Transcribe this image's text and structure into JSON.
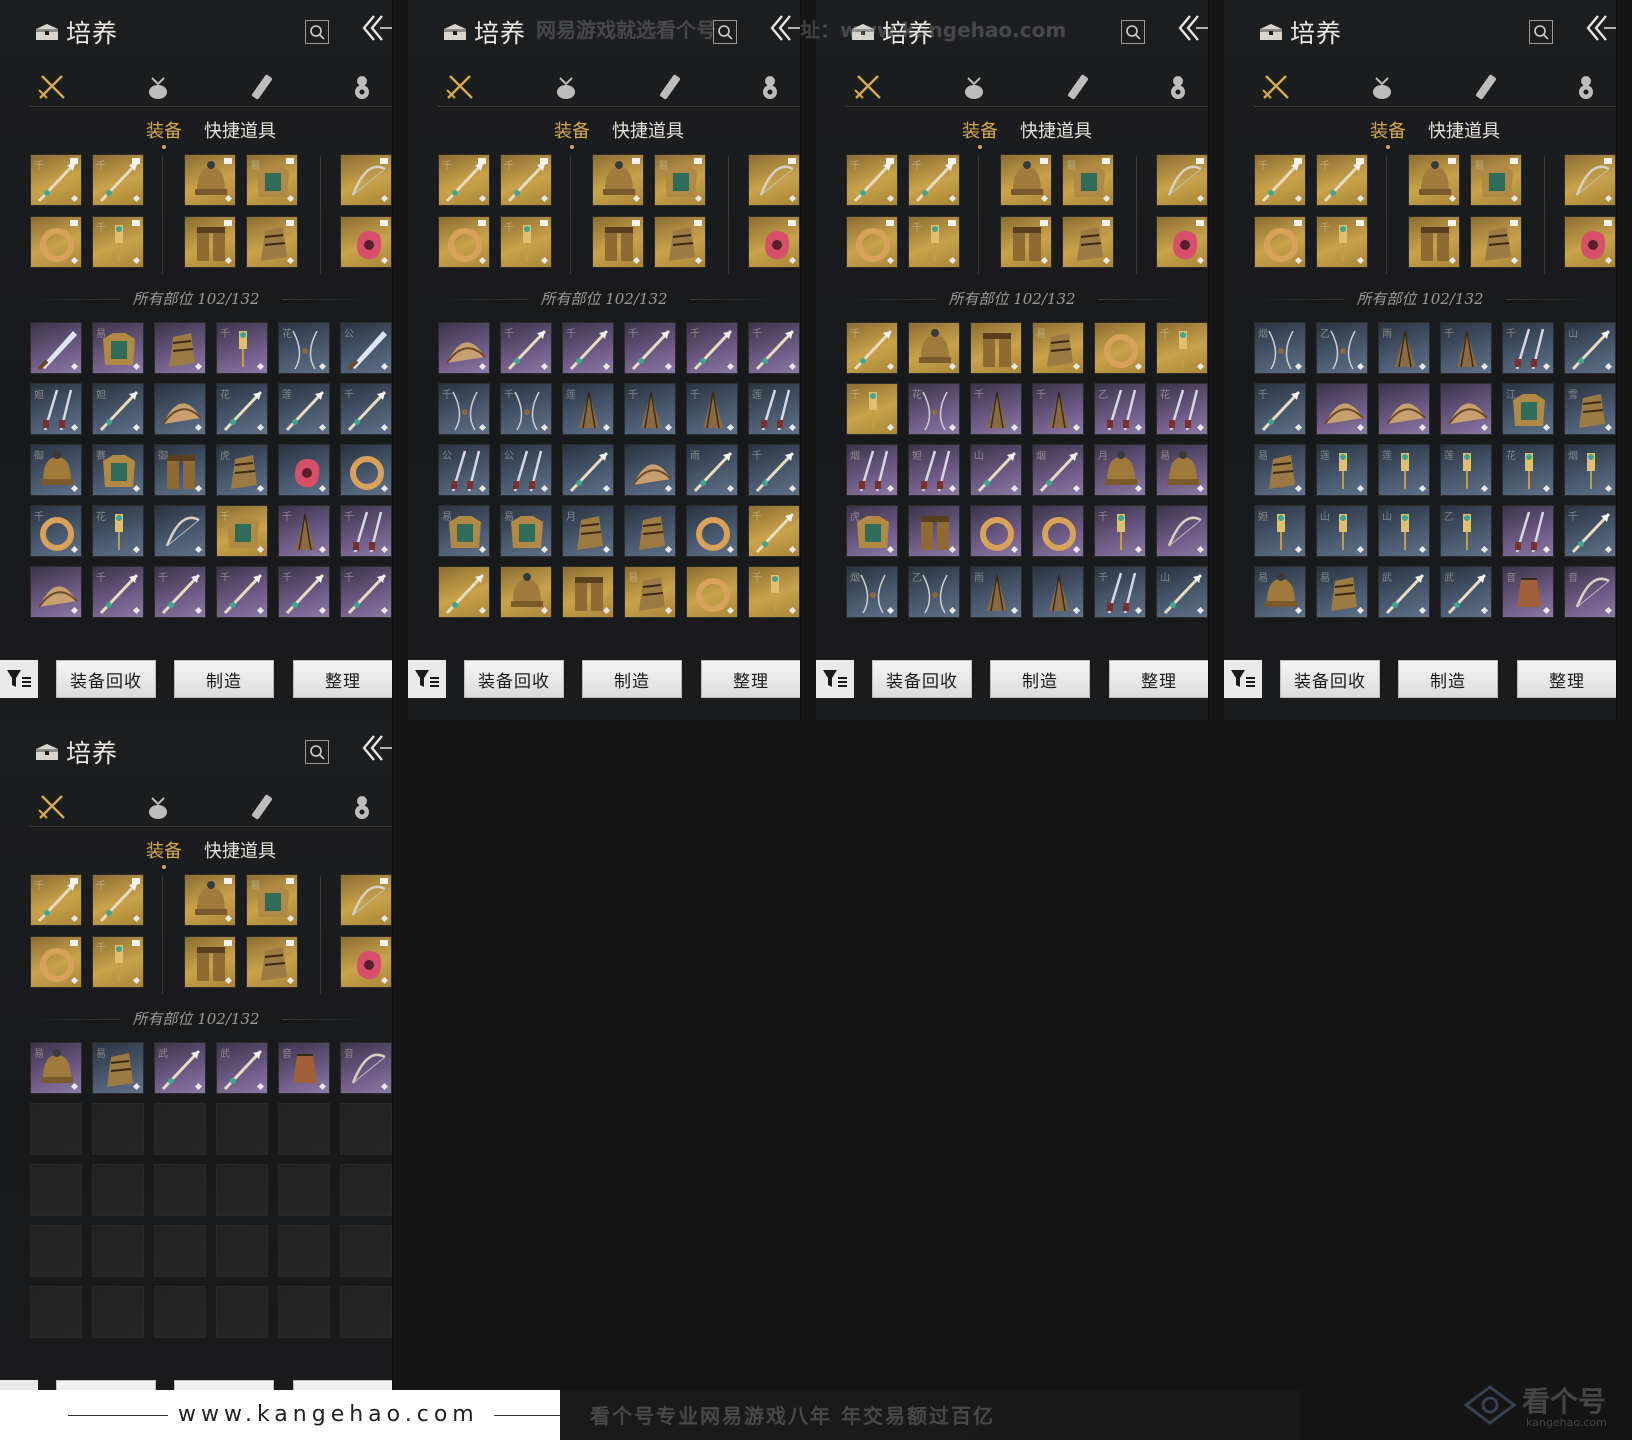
{
  "header": {
    "title": "培养"
  },
  "tabs": {
    "equip": "装备",
    "quick": "快捷道具"
  },
  "summary": "所有部位 102/132",
  "buttons": {
    "recycle": "装备回收",
    "craft": "制造",
    "sort": "整理"
  },
  "categories": [
    "weapon-swords-icon",
    "pouch-icon",
    "scroll-icon",
    "gourd-icon"
  ],
  "colors": {
    "gold": "#d4a94f",
    "legendary": "#c9a24a",
    "epic": "#6e5b86",
    "rare": "#4a5a70",
    "empty": "#2a2a2a"
  },
  "equipped": [
    [
      {
        "g": "千",
        "r": "gold",
        "t": "spear"
      },
      {
        "g": "千",
        "r": "gold",
        "t": "spear"
      },
      null,
      {
        "g": "",
        "r": "gold",
        "t": "helm"
      },
      {
        "g": "易",
        "r": "gold",
        "t": "armor"
      },
      null,
      {
        "g": "",
        "r": "gold",
        "t": "bow"
      }
    ],
    [
      {
        "g": "",
        "r": "gold",
        "t": "ring"
      },
      {
        "g": "千",
        "r": "gold",
        "t": "tassel"
      },
      null,
      {
        "g": "",
        "r": "gold",
        "t": "legs"
      },
      {
        "g": "",
        "r": "gold",
        "t": "glove"
      },
      null,
      {
        "g": "",
        "r": "gold",
        "t": "jade"
      }
    ]
  ],
  "panels": [
    {
      "inventory": [
        [
          {
            "g": "",
            "r": "epic",
            "t": "blade"
          },
          {
            "g": "易",
            "r": "epic",
            "t": "armor"
          },
          {
            "g": "",
            "r": "epic",
            "t": "glove"
          },
          {
            "g": "千",
            "r": "epic",
            "t": "tassel"
          },
          {
            "g": "花",
            "r": "rare",
            "t": "chain"
          },
          {
            "g": "公",
            "r": "rare",
            "t": "blade"
          }
        ],
        [
          {
            "g": "妲",
            "r": "rare",
            "t": "twin"
          },
          {
            "g": "妲",
            "r": "rare",
            "t": "spear"
          },
          {
            "g": "",
            "r": "rare",
            "t": "fan"
          },
          {
            "g": "花",
            "r": "rare",
            "t": "spear"
          },
          {
            "g": "莲",
            "r": "rare",
            "t": "spear"
          },
          {
            "g": "千",
            "r": "rare",
            "t": "spear"
          }
        ],
        [
          {
            "g": "御",
            "r": "rare",
            "t": "helm"
          },
          {
            "g": "赛",
            "r": "rare",
            "t": "armor"
          },
          {
            "g": "御",
            "r": "rare",
            "t": "legs"
          },
          {
            "g": "虎",
            "r": "rare",
            "t": "glove"
          },
          {
            "g": "",
            "r": "rare",
            "t": "jade"
          },
          {
            "g": "",
            "r": "rare",
            "t": "ring"
          }
        ],
        [
          {
            "g": "千",
            "r": "rare",
            "t": "ring"
          },
          {
            "g": "花",
            "r": "rare",
            "t": "tassel"
          },
          {
            "g": "",
            "r": "rare",
            "t": "bow"
          },
          {
            "g": "千",
            "r": "gold",
            "t": "armor"
          },
          {
            "g": "千",
            "r": "epic",
            "t": "fanw"
          },
          {
            "g": "千",
            "r": "epic",
            "t": "twin"
          }
        ],
        [
          {
            "g": "",
            "r": "epic",
            "t": "fan"
          },
          {
            "g": "千",
            "r": "epic",
            "t": "spear"
          },
          {
            "g": "千",
            "r": "epic",
            "t": "spear"
          },
          {
            "g": "千",
            "r": "epic",
            "t": "spear"
          },
          {
            "g": "千",
            "r": "epic",
            "t": "spear"
          },
          {
            "g": "千",
            "r": "epic",
            "t": "spear"
          }
        ]
      ]
    },
    {
      "inventory": [
        [
          {
            "g": "",
            "r": "epic",
            "t": "fan"
          },
          {
            "g": "千",
            "r": "epic",
            "t": "spear"
          },
          {
            "g": "千",
            "r": "epic",
            "t": "spear"
          },
          {
            "g": "千",
            "r": "epic",
            "t": "spear"
          },
          {
            "g": "千",
            "r": "epic",
            "t": "spear"
          },
          {
            "g": "千",
            "r": "epic",
            "t": "spear"
          }
        ],
        [
          {
            "g": "千",
            "r": "rare",
            "t": "chain"
          },
          {
            "g": "千",
            "r": "rare",
            "t": "chain"
          },
          {
            "g": "莲",
            "r": "rare",
            "t": "fanw"
          },
          {
            "g": "千",
            "r": "rare",
            "t": "fanw"
          },
          {
            "g": "千",
            "r": "rare",
            "t": "fanw"
          },
          {
            "g": "莲",
            "r": "rare",
            "t": "twin"
          }
        ],
        [
          {
            "g": "公",
            "r": "rare",
            "t": "twin"
          },
          {
            "g": "公",
            "r": "rare",
            "t": "twin"
          },
          {
            "g": "",
            "r": "rare",
            "t": "spear"
          },
          {
            "g": "",
            "r": "rare",
            "t": "fan"
          },
          {
            "g": "雨",
            "r": "rare",
            "t": "spear"
          },
          {
            "g": "千",
            "r": "rare",
            "t": "spear"
          }
        ],
        [
          {
            "g": "易",
            "r": "rare",
            "t": "armor"
          },
          {
            "g": "易",
            "r": "rare",
            "t": "armor"
          },
          {
            "g": "月",
            "r": "rare",
            "t": "glove"
          },
          {
            "g": "",
            "r": "rare",
            "t": "glove"
          },
          {
            "g": "",
            "r": "rare",
            "t": "ring"
          },
          {
            "g": "千",
            "r": "gold",
            "t": "spear"
          }
        ],
        [
          {
            "g": "",
            "r": "gold",
            "t": "spear"
          },
          {
            "g": "",
            "r": "gold",
            "t": "helm"
          },
          {
            "g": "",
            "r": "gold",
            "t": "legs"
          },
          {
            "g": "易",
            "r": "gold",
            "t": "glove"
          },
          {
            "g": "",
            "r": "gold",
            "t": "ring"
          },
          {
            "g": "千",
            "r": "gold",
            "t": "tassel"
          }
        ]
      ]
    },
    {
      "inventory": [
        [
          {
            "g": "千",
            "r": "gold",
            "t": "spear"
          },
          {
            "g": "",
            "r": "gold",
            "t": "helm"
          },
          {
            "g": "",
            "r": "gold",
            "t": "legs"
          },
          {
            "g": "易",
            "r": "gold",
            "t": "glove"
          },
          {
            "g": "",
            "r": "gold",
            "t": "ring"
          },
          {
            "g": "千",
            "r": "gold",
            "t": "tassel"
          }
        ],
        [
          {
            "g": "千",
            "r": "gold",
            "t": "tassel"
          },
          {
            "g": "花",
            "r": "epic",
            "t": "chain"
          },
          {
            "g": "千",
            "r": "epic",
            "t": "fanw"
          },
          {
            "g": "千",
            "r": "epic",
            "t": "fanw"
          },
          {
            "g": "乙",
            "r": "epic",
            "t": "twin"
          },
          {
            "g": "花",
            "r": "epic",
            "t": "twin"
          }
        ],
        [
          {
            "g": "烟",
            "r": "epic",
            "t": "twin"
          },
          {
            "g": "妲",
            "r": "epic",
            "t": "twin"
          },
          {
            "g": "山",
            "r": "epic",
            "t": "spear"
          },
          {
            "g": "烟",
            "r": "epic",
            "t": "spear"
          },
          {
            "g": "月",
            "r": "epic",
            "t": "helm"
          },
          {
            "g": "易",
            "r": "epic",
            "t": "helm"
          }
        ],
        [
          {
            "g": "虎",
            "r": "epic",
            "t": "armor"
          },
          {
            "g": "",
            "r": "epic",
            "t": "legs"
          },
          {
            "g": "",
            "r": "epic",
            "t": "ring"
          },
          {
            "g": "",
            "r": "epic",
            "t": "ring"
          },
          {
            "g": "千",
            "r": "epic",
            "t": "tassel"
          },
          {
            "g": "",
            "r": "epic",
            "t": "bow"
          }
        ],
        [
          {
            "g": "烟",
            "r": "rare",
            "t": "chain"
          },
          {
            "g": "乙",
            "r": "rare",
            "t": "chain"
          },
          {
            "g": "雨",
            "r": "rare",
            "t": "fanw"
          },
          {
            "g": "",
            "r": "rare",
            "t": "fanw"
          },
          {
            "g": "千",
            "r": "rare",
            "t": "twin"
          },
          {
            "g": "山",
            "r": "rare",
            "t": "spear"
          }
        ]
      ]
    },
    {
      "inventory": [
        [
          {
            "g": "烟",
            "r": "rare",
            "t": "chain"
          },
          {
            "g": "乙",
            "r": "rare",
            "t": "chain"
          },
          {
            "g": "雨",
            "r": "rare",
            "t": "fanw"
          },
          {
            "g": "千",
            "r": "rare",
            "t": "fanw"
          },
          {
            "g": "千",
            "r": "rare",
            "t": "twin"
          },
          {
            "g": "山",
            "r": "rare",
            "t": "spear"
          }
        ],
        [
          {
            "g": "千",
            "r": "rare",
            "t": "spear"
          },
          {
            "g": "",
            "r": "epic",
            "t": "fan"
          },
          {
            "g": "",
            "r": "epic",
            "t": "fan"
          },
          {
            "g": "",
            "r": "epic",
            "t": "fan"
          },
          {
            "g": "江",
            "r": "rare",
            "t": "armor"
          },
          {
            "g": "雪",
            "r": "rare",
            "t": "glove"
          }
        ],
        [
          {
            "g": "易",
            "r": "rare",
            "t": "glove"
          },
          {
            "g": "莲",
            "r": "rare",
            "t": "tassel"
          },
          {
            "g": "莲",
            "r": "rare",
            "t": "tassel"
          },
          {
            "g": "莲",
            "r": "rare",
            "t": "tassel"
          },
          {
            "g": "花",
            "r": "rare",
            "t": "tassel"
          },
          {
            "g": "烟",
            "r": "rare",
            "t": "tassel"
          }
        ],
        [
          {
            "g": "妲",
            "r": "rare",
            "t": "tassel"
          },
          {
            "g": "山",
            "r": "rare",
            "t": "tassel"
          },
          {
            "g": "山",
            "r": "rare",
            "t": "tassel"
          },
          {
            "g": "乙",
            "r": "rare",
            "t": "tassel"
          },
          {
            "g": "",
            "r": "epic",
            "t": "twin"
          },
          {
            "g": "千",
            "r": "rare",
            "t": "spear"
          }
        ],
        [
          {
            "g": "易",
            "r": "rare",
            "t": "helm"
          },
          {
            "g": "易",
            "r": "rare",
            "t": "glove"
          },
          {
            "g": "武",
            "r": "rare",
            "t": "spear"
          },
          {
            "g": "武",
            "r": "rare",
            "t": "spear"
          },
          {
            "g": "音",
            "r": "epic",
            "t": "pouch"
          },
          {
            "g": "音",
            "r": "epic",
            "t": "bow"
          }
        ]
      ]
    },
    {
      "inventory": [
        [
          {
            "g": "易",
            "r": "epic",
            "t": "helm"
          },
          {
            "g": "易",
            "r": "rare",
            "t": "glove"
          },
          {
            "g": "武",
            "r": "epic",
            "t": "spear"
          },
          {
            "g": "武",
            "r": "epic",
            "t": "spear"
          },
          {
            "g": "音",
            "r": "epic",
            "t": "pouch"
          },
          {
            "g": "音",
            "r": "epic",
            "t": "bow"
          }
        ],
        [
          null,
          null,
          null,
          null,
          null,
          null
        ],
        [
          null,
          null,
          null,
          null,
          null,
          null
        ],
        [
          null,
          null,
          null,
          null,
          null,
          null
        ],
        [
          null,
          null,
          null,
          null,
          null,
          null
        ]
      ]
    }
  ],
  "watermarks": {
    "w1": "网易游戏就选看个号",
    "w2": "址：www.kangehao.com"
  },
  "footer": {
    "url": "www.kangehao.com",
    "slogan": "看个号专业网易游戏八年    年交易额过百亿",
    "brand": "看个号",
    "brand_sub": "kangehao.com"
  }
}
